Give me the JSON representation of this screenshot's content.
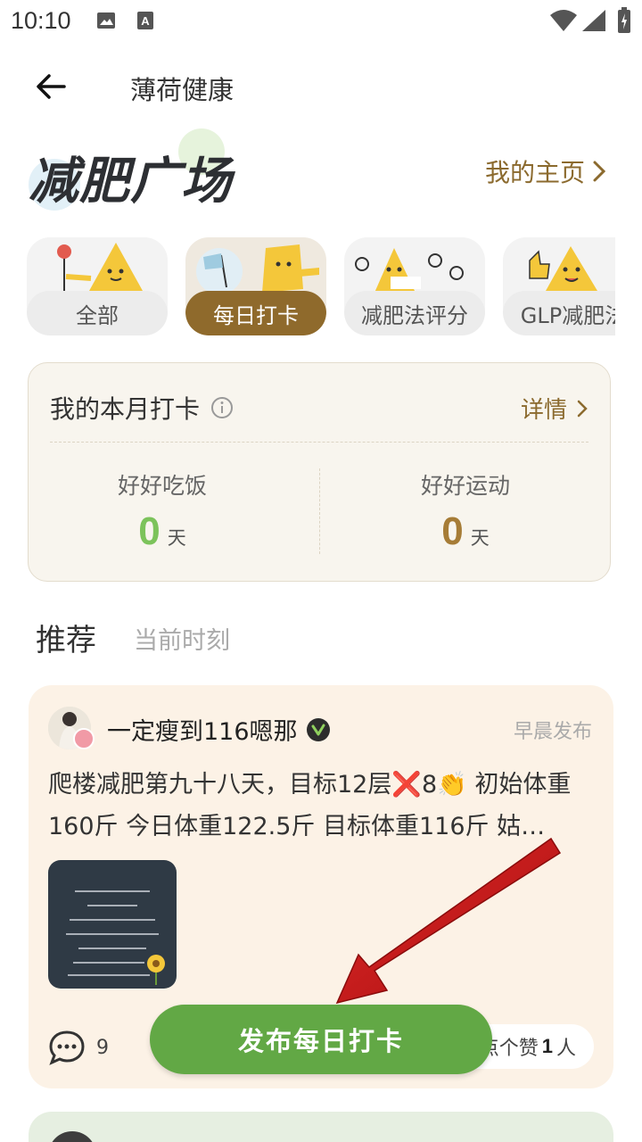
{
  "status_bar": {
    "time": "10:10",
    "icons": [
      "image-icon",
      "text-icon",
      "wifi-icon",
      "signal-icon",
      "battery-icon"
    ]
  },
  "header": {
    "back_icon": "arrow-left-icon",
    "title": "薄荷健康"
  },
  "hero": {
    "title": "减肥广场",
    "my_home_label": "我的主页",
    "chevron_icon": "chevron-right-icon"
  },
  "categories": [
    {
      "label": "全部",
      "active": false
    },
    {
      "label": "每日打卡",
      "active": true
    },
    {
      "label": "减肥法评分",
      "active": false
    },
    {
      "label": "GLP减肥法",
      "active": false
    }
  ],
  "monthly_card": {
    "title": "我的本月打卡",
    "info_icon": "info-icon",
    "detail_label": "详情",
    "stats": [
      {
        "label": "好好吃饭",
        "value": "0",
        "unit": "天",
        "color": "#7cc35b"
      },
      {
        "label": "好好运动",
        "value": "0",
        "unit": "天",
        "color": "#a67c36"
      }
    ]
  },
  "feed_tabs": {
    "recommend": "推荐",
    "now": "当前时刻"
  },
  "post": {
    "author": "一定瘦到116嗯那",
    "time": "早晨发布",
    "text": "爬楼减肥第九十八天，目标12层❌8👏 初始体重160斤 今日体重122.5斤 目标体重116斤 姑…",
    "comment_count": "9",
    "like_prefix": "点个赞",
    "like_count": "1",
    "like_suffix": "人"
  },
  "fab": {
    "label": "发布每日打卡"
  },
  "colors": {
    "brand_brown": "#8f6a2c",
    "brand_green": "#62a845",
    "annotation_red": "#c81414"
  }
}
